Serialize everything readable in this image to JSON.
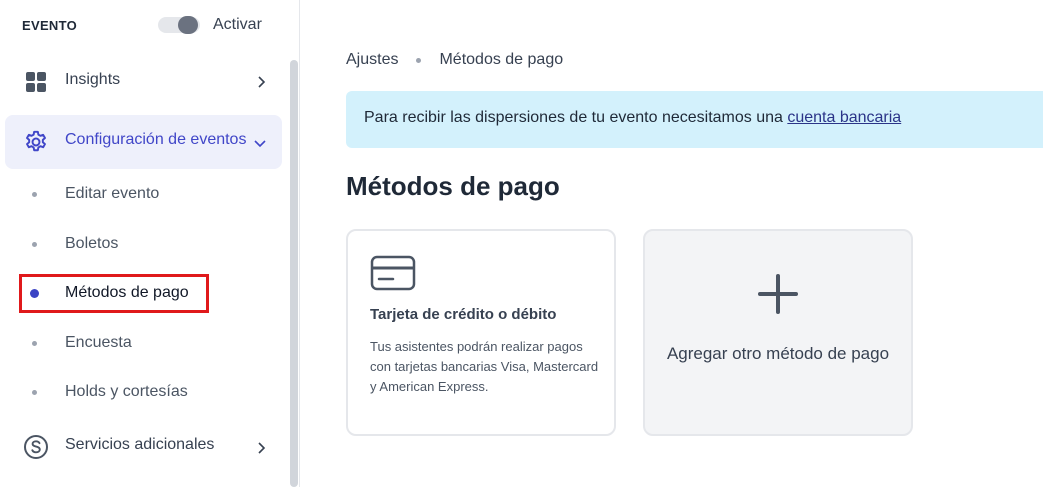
{
  "sidebar": {
    "event_label": "EVENTO",
    "toggle_label": "Activar",
    "items": [
      {
        "label": "Insights",
        "icon": "grid-icon"
      },
      {
        "label": "Configuración de eventos",
        "icon": "gear-icon"
      },
      {
        "label": "Servicios adicionales",
        "icon": "dollar-circle-icon"
      }
    ],
    "subitems": [
      {
        "label": "Editar evento"
      },
      {
        "label": "Boletos"
      },
      {
        "label": "Métodos de pago"
      },
      {
        "label": "Encuesta"
      },
      {
        "label": "Holds y cortesías"
      }
    ]
  },
  "breadcrumb": {
    "parent": "Ajustes",
    "current": "Métodos de pago"
  },
  "alert": {
    "text": "Para recibir las dispersiones de tu evento necesitamos una ",
    "link": "cuenta bancaria"
  },
  "main": {
    "title": "Métodos de pago",
    "card": {
      "title": "Tarjeta de crédito o débito",
      "description": "Tus asistentes podrán realizar pagos con tarjetas bancarias Visa, Mastercard y American Express."
    },
    "add_card": {
      "label": "Agregar otro método de pago"
    }
  },
  "colors": {
    "accent": "#4046c8",
    "alert_bg": "#d3f1fc",
    "highlight": "#e0191b"
  }
}
